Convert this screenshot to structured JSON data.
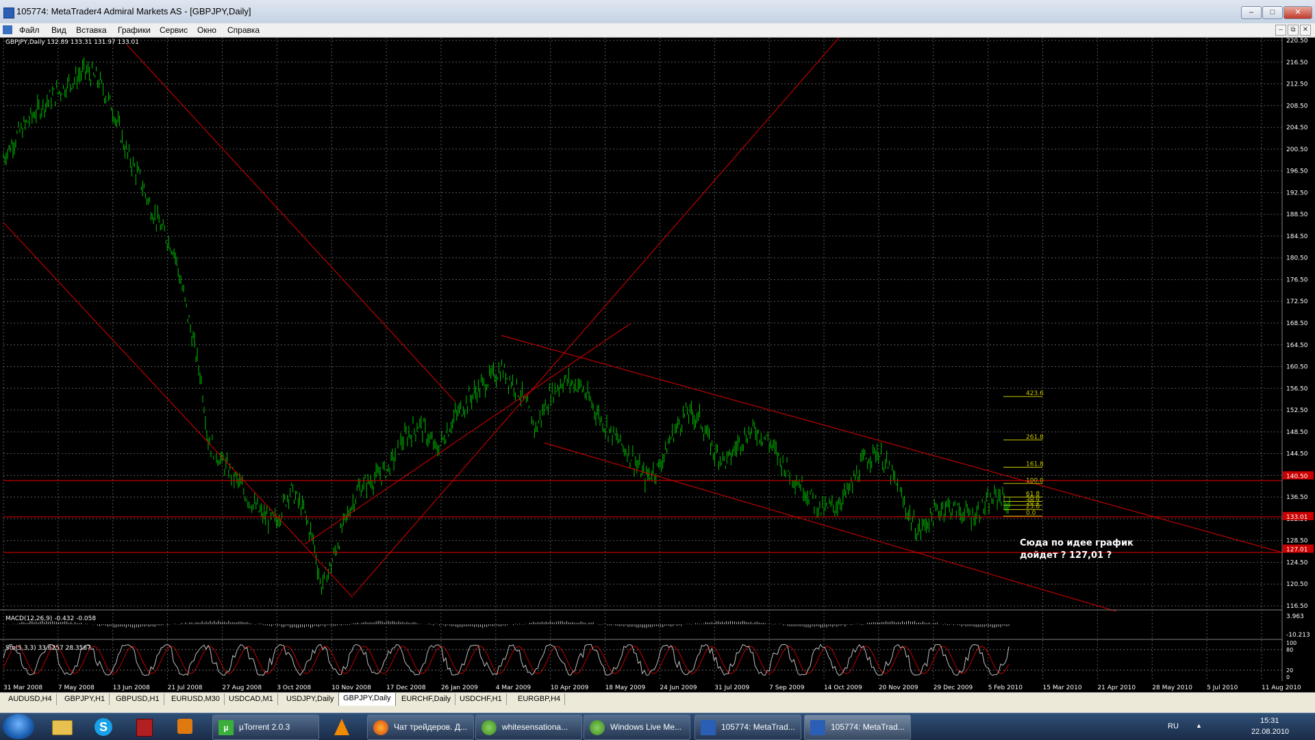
{
  "window": {
    "title": "105774: MetaTrader4 Admiral Markets AS - [GBPJPY,Daily]",
    "controls": {
      "minimize": "–",
      "maximize": "□",
      "close": "✕"
    }
  },
  "menu": {
    "items": [
      "Файл",
      "Вид",
      "Вставка",
      "Графики",
      "Сервис",
      "Окно",
      "Справка"
    ],
    "mdi_controls": {
      "minimize": "–",
      "restore": "⧉",
      "close": "✕"
    }
  },
  "chart": {
    "symbol_info": "GBPJPY,Daily  132.89 133.31 131.97 133.01",
    "macd_label": "MACD(12,26,9) -0.432 -0.058",
    "stoch_label": "Sto(5,3,3) 33.6257 28.3567",
    "price_scale": [
      "220.50",
      "216.50",
      "212.50",
      "208.50",
      "204.50",
      "200.50",
      "196.50",
      "192.50",
      "188.50",
      "184.50",
      "180.50",
      "176.50",
      "172.50",
      "168.50",
      "164.50",
      "160.50",
      "156.50",
      "152.50",
      "148.50",
      "144.50",
      "140.50",
      "136.50",
      "132.50",
      "128.50",
      "124.50",
      "120.50",
      "116.50"
    ],
    "price_tags": [
      {
        "label": "140.50",
        "value": 140.5,
        "color": "#cc0000"
      },
      {
        "label": "133.01",
        "value": 133.01,
        "color": "#cc0000"
      },
      {
        "label": "127.01",
        "value": 127.01,
        "color": "#cc0000"
      }
    ],
    "macd_scale": [
      "3.963",
      "-10.213"
    ],
    "stoch_scale": [
      "100",
      "80",
      "20",
      "0"
    ],
    "date_axis": [
      "31 Mar 2008",
      "7 May 2008",
      "13 Jun 2008",
      "21 Jul 2008",
      "27 Aug 2008",
      "3 Oct 2008",
      "10 Nov 2008",
      "17 Dec 2008",
      "26 Jan 2009",
      "4 Mar 2009",
      "10 Apr 2009",
      "18 May 2009",
      "24 Jun 2009",
      "31 Jul 2009",
      "7 Sep 2009",
      "14 Oct 2009",
      "20 Nov 2009",
      "29 Dec 2009",
      "5 Feb 2010",
      "15 Mar 2010",
      "21 Apr 2010",
      "28 May 2010",
      "5 Jul 2010",
      "11 Aug 2010"
    ],
    "fibo_levels": [
      "423.6",
      "261.8",
      "161.8",
      "100.0",
      "61.8",
      "50.0",
      "38.2",
      "23.6",
      "0.0"
    ],
    "annotation_line1": "Сюда по идее график",
    "annotation_line2": "дойдет ? 127,01 ?",
    "colors": {
      "candles": "#00c000",
      "trendlines": "#c00000",
      "fibo": "#c8c800",
      "grid": "#5a5a5a"
    }
  },
  "tabs": [
    "AUDUSD,H4",
    "GBPJPY,H1",
    "GBPUSD,H1",
    "EURUSD,M30",
    "USDCAD,M1",
    "USDJPY,Daily",
    "GBPJPY,Daily",
    "EURCHF,Daily",
    "USDCHF,H1",
    "EURGBP,H4"
  ],
  "active_tab": "GBPJPY,Daily",
  "taskbar": {
    "buttons": [
      "µTorrent 2.0.3",
      "Чат трейдеров. Д...",
      "whitesensationa...",
      "Windows Live Me...",
      "105774: MetaTrad...",
      "105774: MetaTrad..."
    ],
    "language": "RU",
    "time": "15:31",
    "date": "22.08.2010"
  }
}
